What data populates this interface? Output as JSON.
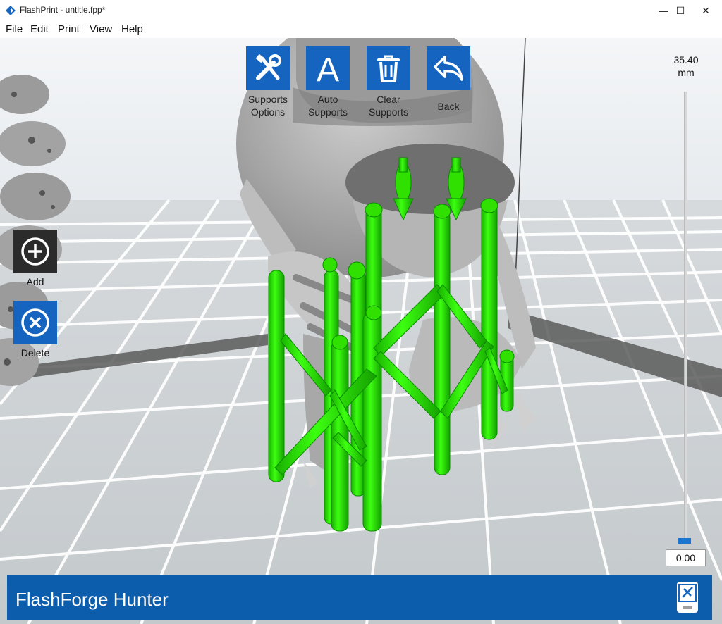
{
  "window": {
    "title": "FlashPrint - untitle.fpp*",
    "controls": {
      "minimize": "—",
      "maximize": "☐",
      "close": "✕"
    }
  },
  "menu": {
    "items": [
      {
        "label": "File"
      },
      {
        "label": "Edit"
      },
      {
        "label": "Print"
      },
      {
        "label": "View"
      },
      {
        "label": "Help"
      }
    ]
  },
  "toolbar": {
    "supports_options": {
      "line1": "Supports",
      "line2": "Options",
      "icon": "tools-icon"
    },
    "auto_supports": {
      "line1": "Auto",
      "line2": "Supports",
      "icon": "letter-a-icon"
    },
    "clear_supports": {
      "line1": "Clear",
      "line2": "Supports",
      "icon": "trash-icon"
    },
    "back": {
      "label": "Back",
      "icon": "back-arrow-icon"
    }
  },
  "side_tools": {
    "add": {
      "label": "Add",
      "icon": "plus-circle-icon"
    },
    "delete": {
      "label": "Delete",
      "icon": "x-circle-icon"
    }
  },
  "layer_slider": {
    "max_value": "35.40",
    "unit": "mm",
    "current_value": "0.00"
  },
  "status": {
    "printer_name": "FlashForge Hunter",
    "connection_icon": "connection-icon"
  },
  "colors": {
    "accent": "#1565c0",
    "status_bar": "#0d5dad",
    "support_green": "#22e000",
    "model_gray": "#a8a8a8"
  }
}
